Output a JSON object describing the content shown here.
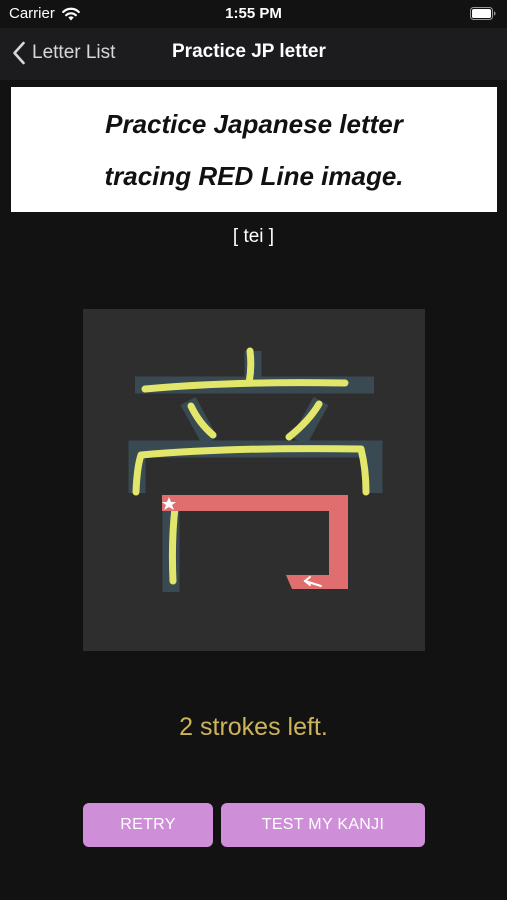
{
  "status_bar": {
    "carrier": "Carrier",
    "time": "1:55 PM"
  },
  "nav": {
    "back_label": "Letter List",
    "title": "Practice JP letter"
  },
  "instruction": {
    "line1": "Practice Japanese letter",
    "line2": "tracing RED Line image."
  },
  "reading": "[ tei ]",
  "strokes_left": "2 strokes left.",
  "buttons": {
    "retry": "RETRY",
    "test": "TEST MY KANJI"
  },
  "colors": {
    "background": "#121212",
    "nav_bar": "#1c1c1e",
    "canvas": "#2e2e2e",
    "guide_stroke": "#3a4a52",
    "traced_stroke": "#e2e66a",
    "next_stroke": "#e06e6e",
    "status_text": "#cdb45a",
    "button": "#cf8fd8"
  },
  "icons": {
    "back": "chevron-left-icon",
    "wifi": "wifi-icon",
    "battery": "battery-icon",
    "start_point": "star-icon",
    "direction": "arrow-icon"
  }
}
